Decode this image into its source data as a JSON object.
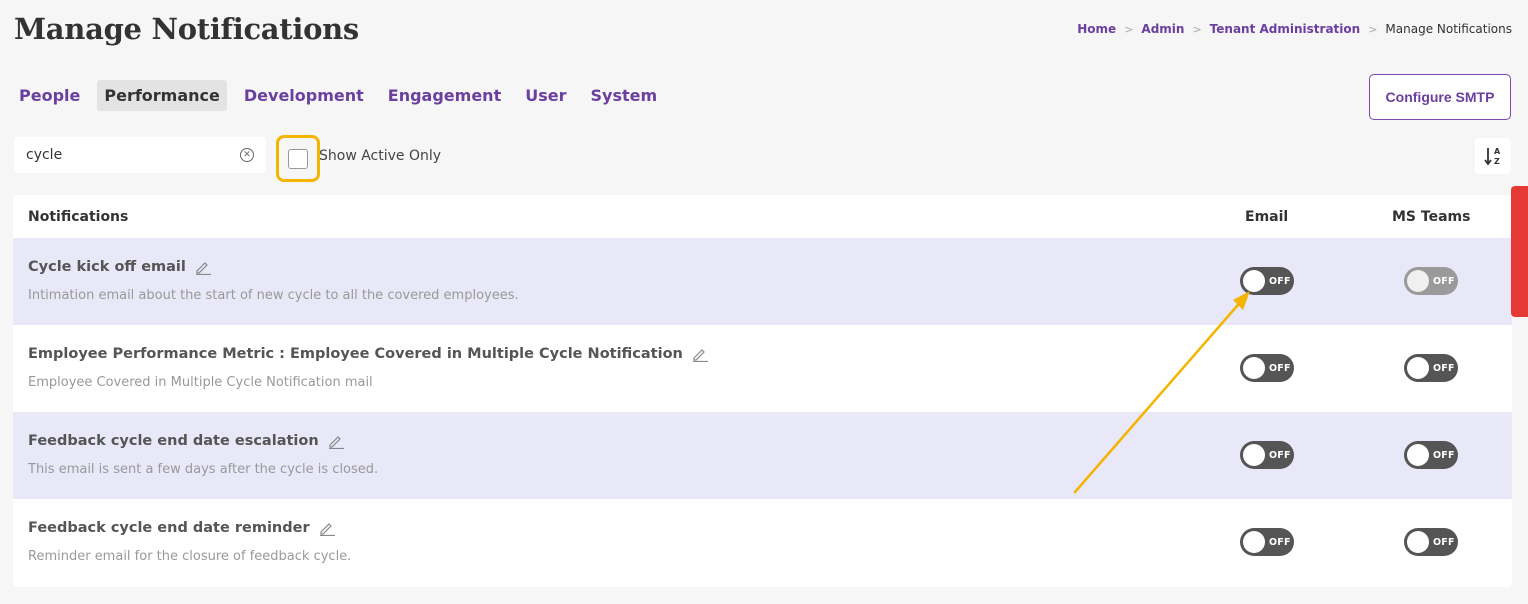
{
  "page": {
    "title": "Manage Notifications"
  },
  "breadcrumb": {
    "items": [
      "Home",
      "Admin",
      "Tenant Administration",
      "Manage Notifications"
    ]
  },
  "tabs": [
    {
      "label": "People",
      "active": false
    },
    {
      "label": "Performance",
      "active": true
    },
    {
      "label": "Development",
      "active": false
    },
    {
      "label": "Engagement",
      "active": false
    },
    {
      "label": "User",
      "active": false
    },
    {
      "label": "System",
      "active": false
    }
  ],
  "toolbar": {
    "configure_smtp_label": "Configure SMTP",
    "search_value": "cycle",
    "show_active_label": "Show Active Only",
    "show_active_checked": false,
    "sort_icon": "sort-alpha-icon"
  },
  "table": {
    "headers": {
      "notifications": "Notifications",
      "email": "Email",
      "ms_teams": "MS Teams"
    },
    "rows": [
      {
        "title": "Cycle kick off email",
        "description": "Intimation email about the start of new cycle to all the covered employees.",
        "email_toggle": "OFF",
        "teams_toggle": "OFF"
      },
      {
        "title": "Employee Performance Metric : Employee Covered in Multiple Cycle Notification",
        "description": "Employee Covered in Multiple Cycle Notification mail",
        "email_toggle": "OFF",
        "teams_toggle": "OFF"
      },
      {
        "title": "Feedback cycle end date escalation",
        "description": "This email is sent a few days after the cycle is closed.",
        "email_toggle": "OFF",
        "teams_toggle": "OFF"
      },
      {
        "title": "Feedback cycle end date reminder",
        "description": "Reminder email for the closure of feedback cycle.",
        "email_toggle": "OFF",
        "teams_toggle": "OFF"
      }
    ]
  },
  "colors": {
    "accent": "#6b3fa0",
    "highlight": "#f4b400",
    "row_shade": "#e8e8f8",
    "side_tab": "#e53935"
  }
}
